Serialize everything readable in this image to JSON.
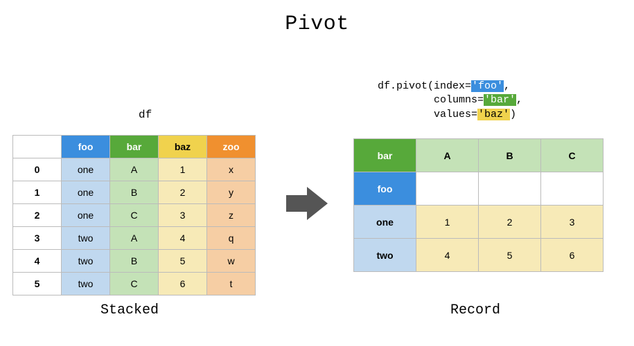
{
  "title": "Pivot",
  "df_label": "df",
  "code": {
    "prefix": "df.pivot(index=",
    "index_lit": "'foo'",
    "comma1": ",",
    "indent": "         ",
    "columns_key": "columns=",
    "columns_lit": "'bar'",
    "comma2": ",",
    "values_key": "values=",
    "values_lit": "'baz'",
    "close": ")"
  },
  "stacked": {
    "caption": "Stacked",
    "headers": [
      "",
      "foo",
      "bar",
      "baz",
      "zoo"
    ],
    "rows": [
      {
        "idx": "0",
        "foo": "one",
        "bar": "A",
        "baz": "1",
        "zoo": "x"
      },
      {
        "idx": "1",
        "foo": "one",
        "bar": "B",
        "baz": "2",
        "zoo": "y"
      },
      {
        "idx": "2",
        "foo": "one",
        "bar": "C",
        "baz": "3",
        "zoo": "z"
      },
      {
        "idx": "3",
        "foo": "two",
        "bar": "A",
        "baz": "4",
        "zoo": "q"
      },
      {
        "idx": "4",
        "foo": "two",
        "bar": "B",
        "baz": "5",
        "zoo": "w"
      },
      {
        "idx": "5",
        "foo": "two",
        "bar": "C",
        "baz": "6",
        "zoo": "t"
      }
    ]
  },
  "record": {
    "caption": "Record",
    "col_axis_name": "bar",
    "row_axis_name": "foo",
    "columns": [
      "A",
      "B",
      "C"
    ],
    "rows": [
      {
        "idx": "one",
        "vals": [
          "1",
          "2",
          "3"
        ]
      },
      {
        "idx": "two",
        "vals": [
          "4",
          "5",
          "6"
        ]
      }
    ]
  },
  "chart_data": {
    "type": "table",
    "title": "Pivot",
    "source_name": "df",
    "source": {
      "columns": [
        "foo",
        "bar",
        "baz",
        "zoo"
      ],
      "index": [
        0,
        1,
        2,
        3,
        4,
        5
      ],
      "data": [
        [
          "one",
          "A",
          1,
          "x"
        ],
        [
          "one",
          "B",
          2,
          "y"
        ],
        [
          "one",
          "C",
          3,
          "z"
        ],
        [
          "two",
          "A",
          4,
          "q"
        ],
        [
          "two",
          "B",
          5,
          "w"
        ],
        [
          "two",
          "C",
          6,
          "t"
        ]
      ]
    },
    "operation": "pivot(index='foo', columns='bar', values='baz')",
    "result": {
      "index_name": "foo",
      "columns_name": "bar",
      "columns": [
        "A",
        "B",
        "C"
      ],
      "index": [
        "one",
        "two"
      ],
      "data": [
        [
          1,
          2,
          3
        ],
        [
          4,
          5,
          6
        ]
      ]
    }
  }
}
